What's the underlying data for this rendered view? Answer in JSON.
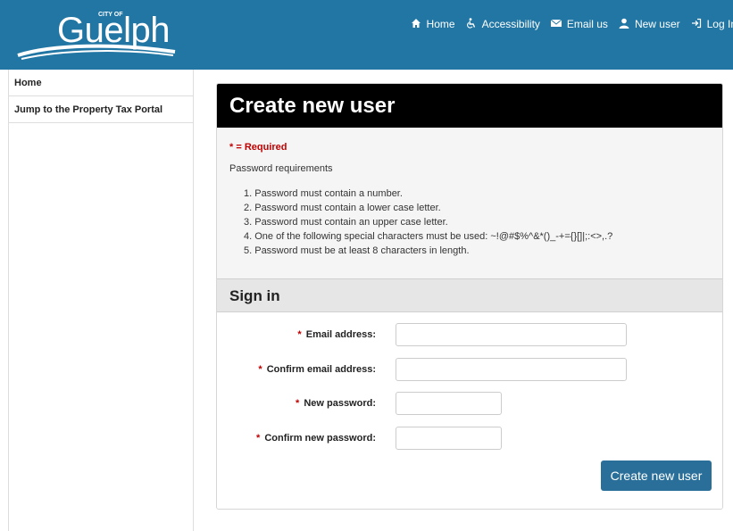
{
  "header": {
    "logo": {
      "city_of": "CITY OF",
      "name": "Guelph"
    },
    "nav": [
      {
        "label": "Home",
        "icon": "home-icon"
      },
      {
        "label": "Accessibility",
        "icon": "accessibility-icon"
      },
      {
        "label": "Email us",
        "icon": "envelope-icon"
      },
      {
        "label": "New user",
        "icon": "user-icon"
      },
      {
        "label": "Log In",
        "icon": "sign-in-icon"
      }
    ],
    "bg_color": "#2176a4"
  },
  "sidebar": {
    "items": [
      {
        "label": "Home"
      },
      {
        "label": "Jump to the Property Tax Portal"
      }
    ]
  },
  "panel": {
    "title": "Create new user",
    "required_note": "* = Required",
    "password_title": "Password requirements",
    "password_rules": [
      "1. Password must contain a number.",
      "2. Password must contain a lower case letter.",
      "3. Password must contain an upper case letter.",
      "4. One of the following special characters must be used: ~!@#$%^&*()_-+={}[]|;:<>,.?",
      "5. Password must be at least 8 characters in length."
    ],
    "signin_title": "Sign in"
  },
  "form": {
    "fields": [
      {
        "label": "Email address:",
        "value": ""
      },
      {
        "label": "Confirm email address:",
        "value": ""
      },
      {
        "label": "New password:",
        "value": ""
      },
      {
        "label": "Confirm new password:",
        "value": ""
      }
    ],
    "required_mark": "*",
    "submit_label": "Create new user",
    "accent_color": "#2a6f99",
    "required_color": "#c00000"
  }
}
